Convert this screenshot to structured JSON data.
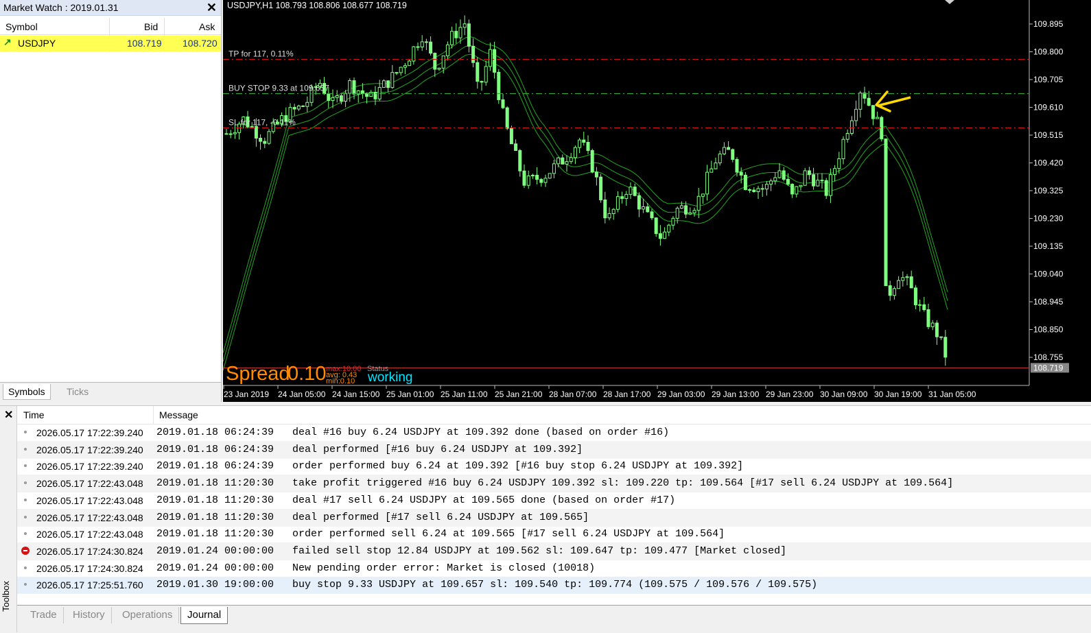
{
  "market_watch": {
    "title": "Market Watch : 2019.01.31",
    "columns": [
      "Symbol",
      "Bid",
      "Ask"
    ],
    "rows": [
      {
        "symbol": "USDJPY",
        "bid": "108.719",
        "ask": "108.720",
        "direction_icon": "up-arrow-icon",
        "highlight_color": "#ffff54"
      }
    ],
    "tabs": [
      "Symbols",
      "Ticks"
    ]
  },
  "chart": {
    "header": "USDJPY,H1  108.793 108.806 108.677 108.719",
    "price_labels": [
      "109.895",
      "109.800",
      "109.705",
      "109.610",
      "109.515",
      "109.420",
      "109.325",
      "109.230",
      "109.135",
      "109.040",
      "108.945",
      "108.850",
      "108.755"
    ],
    "current_price": "108.719",
    "time_labels": [
      "23 Jan 2019",
      "24 Jan 05:00",
      "24 Jan 15:00",
      "25 Jan 01:00",
      "25 Jan 11:00",
      "25 Jan 21:00",
      "28 Jan 07:00",
      "28 Jan 17:00",
      "29 Jan 03:00",
      "29 Jan 13:00",
      "29 Jan 23:00",
      "30 Jan 09:00",
      "30 Jan 19:00",
      "31 Jan 05:00"
    ],
    "lines": {
      "tp": {
        "label": "TP for 117, 0.11%",
        "price": 109.774,
        "color": "#d01010"
      },
      "buy_stop": {
        "label": "BUY STOP 9.33 at 109.657",
        "price": 109.657,
        "color": "#3aa53a"
      },
      "sl": {
        "label": "SL for 117, -0.11%",
        "price": 109.54,
        "color": "#d01010"
      }
    },
    "spread_panel": {
      "label": "Spread",
      "value": "0.10",
      "max": "max:10.00",
      "avg": "avg: 0.43",
      "min": "min:0.10",
      "status_label": "Status",
      "status_value": "working"
    },
    "colors": {
      "background": "#000000",
      "candle": "#7fff7f",
      "ma": "#22a822",
      "arrow": "#ffd700",
      "bid_line": "#d23a3a"
    }
  },
  "toolbox": {
    "side_label": "Toolbox",
    "columns": [
      "Time",
      "Message"
    ],
    "rows": [
      {
        "icon": "info",
        "time": "2026.05.17 17:22:39.240",
        "message": "2019.01.18 06:24:39   deal #16 buy 6.24 USDJPY at 109.392 done (based on order #16)"
      },
      {
        "icon": "info",
        "time": "2026.05.17 17:22:39.240",
        "message": "2019.01.18 06:24:39   deal performed [#16 buy 6.24 USDJPY at 109.392]"
      },
      {
        "icon": "info",
        "time": "2026.05.17 17:22:39.240",
        "message": "2019.01.18 06:24:39   order performed buy 6.24 at 109.392 [#16 buy stop 6.24 USDJPY at 109.392]"
      },
      {
        "icon": "info",
        "time": "2026.05.17 17:22:43.048",
        "message": "2019.01.18 11:20:30   take profit triggered #16 buy 6.24 USDJPY 109.392 sl: 109.220 tp: 109.564 [#17 sell 6.24 USDJPY at 109.564]"
      },
      {
        "icon": "info",
        "time": "2026.05.17 17:22:43.048",
        "message": "2019.01.18 11:20:30   deal #17 sell 6.24 USDJPY at 109.565 done (based on order #17)"
      },
      {
        "icon": "info",
        "time": "2026.05.17 17:22:43.048",
        "message": "2019.01.18 11:20:30   deal performed [#17 sell 6.24 USDJPY at 109.565]"
      },
      {
        "icon": "info",
        "time": "2026.05.17 17:22:43.048",
        "message": "2019.01.18 11:20:30   order performed sell 6.24 at 109.565 [#17 sell 6.24 USDJPY at 109.564]"
      },
      {
        "icon": "error",
        "time": "2026.05.17 17:24:30.824",
        "message": "2019.01.24 00:00:00   failed sell stop 12.84 USDJPY at 109.562 sl: 109.647 tp: 109.477 [Market closed]"
      },
      {
        "icon": "info",
        "time": "2026.05.17 17:24:30.824",
        "message": "2019.01.24 00:00:00   New pending order error: Market is closed (10018)"
      },
      {
        "icon": "info",
        "time": "2026.05.17 17:25:51.760",
        "message": "2019.01.30 19:00:00   buy stop 9.33 USDJPY at 109.657 sl: 109.540 tp: 109.774 (109.575 / 109.576 / 109.575)"
      }
    ],
    "tabs": [
      "Trade",
      "History",
      "Operations",
      "Journal"
    ],
    "active_tab": "Journal"
  }
}
